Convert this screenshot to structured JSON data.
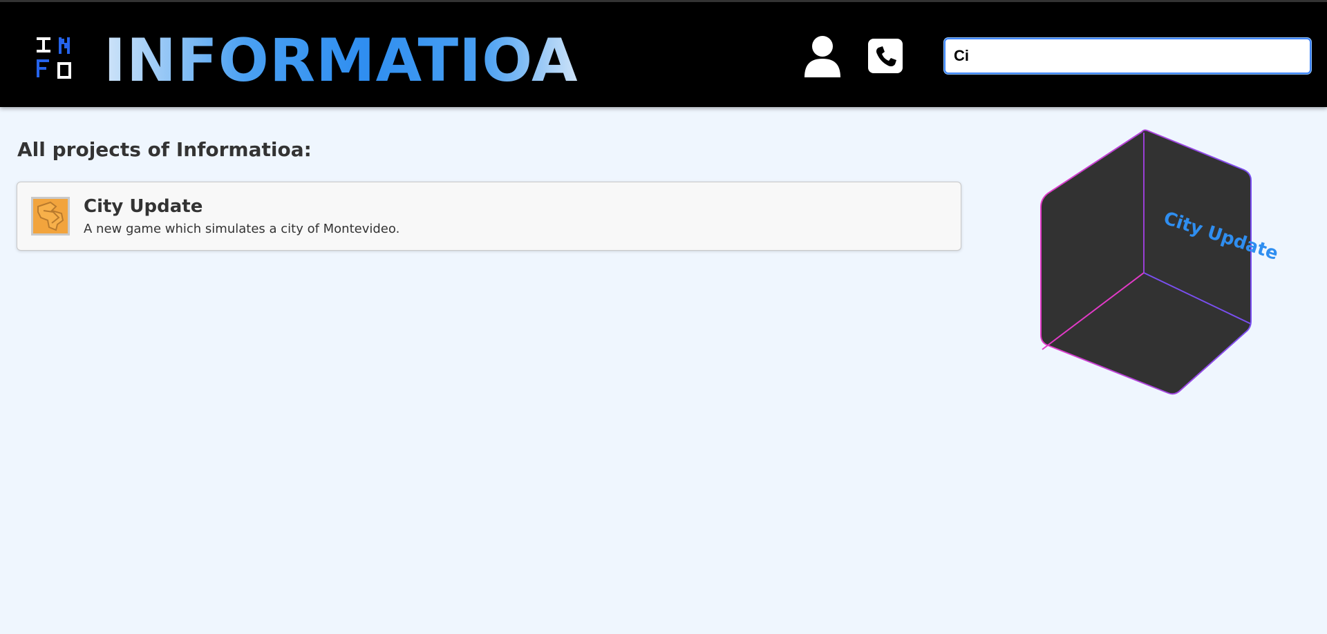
{
  "header": {
    "logo_letters": [
      "I",
      "N",
      "F",
      "O"
    ],
    "brand": "INFORMATIOA",
    "user_icon": "user-icon",
    "phone_icon": "phone-icon",
    "search_value": "Ci"
  },
  "main": {
    "heading": "All projects of Informatioa:",
    "projects": [
      {
        "title": "City Update",
        "description": "A new game which simulates a city of Montevideo.",
        "thumb_icon": "city-update-thumbnail"
      }
    ]
  },
  "preview": {
    "cube_label": "City Update"
  },
  "colors": {
    "header_bg": "#000000",
    "page_bg": "#eff6fe",
    "brand_gradient": [
      "#cfe4f8",
      "#2f8ef0"
    ],
    "cube_face": "#323232",
    "cube_edge_pink": "#e23ac7",
    "cube_edge_violet": "#7a4ff0",
    "cube_label": "#2f8ef0",
    "thumb": "#f2a43d"
  }
}
